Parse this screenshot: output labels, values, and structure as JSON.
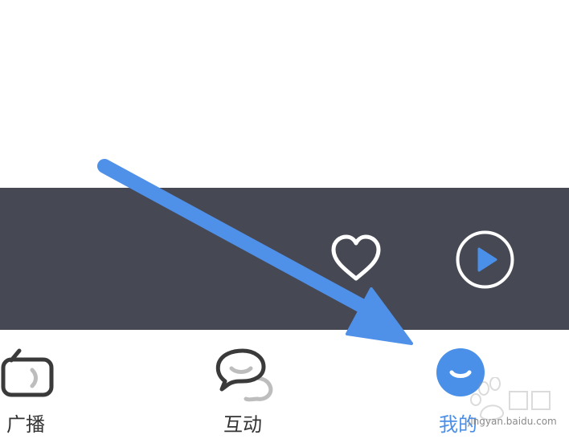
{
  "tabs": [
    {
      "id": "radio",
      "label": "广播",
      "icon": "radio-icon",
      "active": false
    },
    {
      "id": "interact",
      "label": "互动",
      "icon": "chat-bubbles-icon",
      "active": false
    },
    {
      "id": "mine",
      "label": "我的",
      "icon": "profile-smile-icon",
      "active": true
    }
  ],
  "player": {
    "favorite_icon": "heart-outline-icon",
    "play_icon": "play-circle-icon"
  },
  "watermark": {
    "text": "jingyan.baidu.com"
  },
  "annotation": {
    "icon": "arrow-annotation-icon",
    "color": "#4f90e8"
  },
  "colors": {
    "player_bar": "#464853",
    "accent": "#4a8fe8",
    "tab_text": "#333333",
    "icon_dark": "#3a3a3a"
  }
}
